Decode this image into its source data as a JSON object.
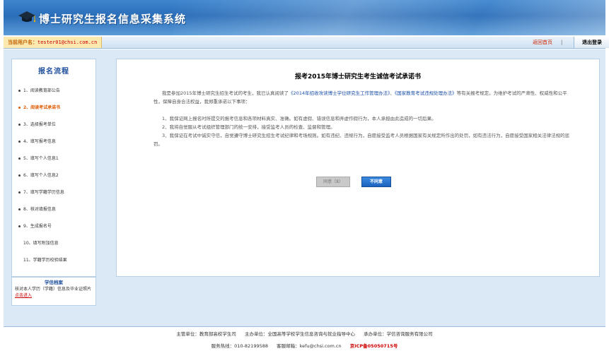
{
  "header": {
    "title": "博士研究生报名信息采集系统"
  },
  "userbar": {
    "user_label": "当前用户名：",
    "user_email": "tester01@chsi.com.cn",
    "home_link": "返回首页",
    "separator": "|",
    "logout_label": "退出登录"
  },
  "sidebar": {
    "title": "报名流程",
    "steps": [
      {
        "label": "1、阅读教育部公告"
      },
      {
        "label": "2、阅读考试承诺书"
      },
      {
        "label": "3、选择报考单位"
      },
      {
        "label": "4、填写报考信息"
      },
      {
        "label": "5、填写个人信息1"
      },
      {
        "label": "6、填写个人信息2"
      },
      {
        "label": "7、填写学籍学历信息"
      },
      {
        "label": "8、核对填报信息"
      },
      {
        "label": "9、生成报名号"
      },
      {
        "label": "10、填写附加信息"
      },
      {
        "label": "11、学籍学历校验结果"
      }
    ],
    "xinxi": {
      "title": "学信档案",
      "desc": "核对本人学历（学籍）信息及毕业证照片",
      "link": "点击进入"
    }
  },
  "content": {
    "title": "报考2015年博士研究生考生诚信考试承诺书",
    "intro_pre": "我是参加2015年博士研究生招生考试的考生，我已认真阅读了",
    "law1": "《2014年招收攻读博士学位研究生工作管理办法》",
    "intro_mid": "、",
    "law2": "《国家教育考试违规处理办法》",
    "intro_post": "等有关报考规定。为维护考试的严肃性、权威性和公平性，保障自身合法权益，我郑重承诺以下事项：",
    "item1": "1、我保证网上报名时所提交的报考信息和各项材料真实、准确。如有虚假、错误信息和弄虚作假行为，本人承担由此造成的一切后果。",
    "item2": "2、我将自觉服从考试组织管理部门的统一安排，接受监考人员的检查、监督和管理。",
    "item3": "3、我保证在考试中诚实守信，自觉遵守博士研究生招生考试纪律和考场规则。如有违纪、违规行为，自愿接受监考人员根据国家有关规定所作出的处罚，如有违法行为，自愿接受国家相关法律法规的惩罚。",
    "agree_button": "同意（8）",
    "disagree_button": "不同意"
  },
  "footer": {
    "sponsor": "主管单位：教育部高校学生司",
    "host": "主办单位：全国高等学校学生信息咨询与就业指导中心",
    "organizer": "承办单位：学信咨询服务有限公司",
    "hotline": "服务热线：010-82199588",
    "email": "客服邮箱：kefu@chsi.com.cn",
    "icp": "京ICP备05050715号"
  }
}
